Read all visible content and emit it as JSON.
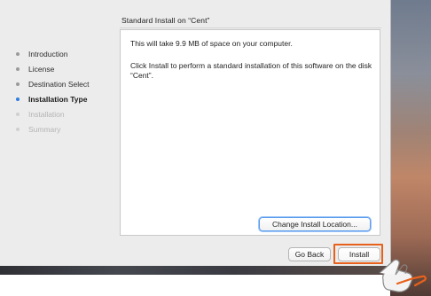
{
  "window": {
    "section_title": "Standard Install on “Cent”"
  },
  "sidebar": {
    "items": [
      {
        "label": "Introduction",
        "state": "done"
      },
      {
        "label": "License",
        "state": "done"
      },
      {
        "label": "Destination Select",
        "state": "done"
      },
      {
        "label": "Installation Type",
        "state": "current"
      },
      {
        "label": "Installation",
        "state": "pending"
      },
      {
        "label": "Summary",
        "state": "pending"
      }
    ]
  },
  "content": {
    "space_message": "This will take 9.9 MB of space on your computer.",
    "install_message": "Click Install to perform a standard installation of this software on the disk “Cent”."
  },
  "buttons": {
    "change_location": "Change Install Location...",
    "go_back": "Go Back",
    "install": "Install"
  },
  "colors": {
    "accent": "#2f7de1",
    "highlight": "#e8611c",
    "window_bg": "#ececec"
  },
  "icons": {
    "pointer": "hand-pointer-icon"
  }
}
